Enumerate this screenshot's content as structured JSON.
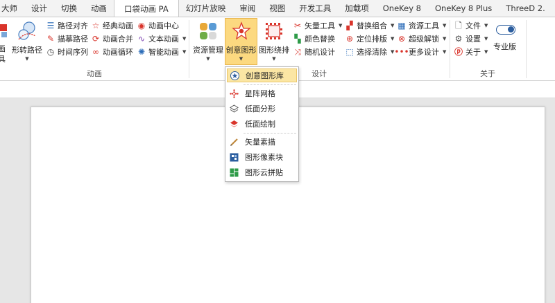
{
  "tabs": [
    {
      "label": "大师",
      "active": false
    },
    {
      "label": "设计",
      "active": false
    },
    {
      "label": "切换",
      "active": false
    },
    {
      "label": "动画",
      "active": false
    },
    {
      "label": "口袋动画 PA",
      "active": true
    },
    {
      "label": "幻灯片放映",
      "active": false
    },
    {
      "label": "审阅",
      "active": false
    },
    {
      "label": "视图",
      "active": false
    },
    {
      "label": "开发工具",
      "active": false
    },
    {
      "label": "加载项",
      "active": false
    },
    {
      "label": "OneKey 8",
      "active": false
    },
    {
      "label": "OneKey 8 Plus",
      "active": false
    },
    {
      "label": "ThreeD 2.",
      "active": false
    }
  ],
  "groups": {
    "animation": {
      "label": "动画",
      "partial_big_top": "画",
      "partial_big_bottom": "具",
      "path_convert": "形转路径",
      "items": [
        "路径对齐",
        "描摹路径",
        "时间序列",
        "经典动画",
        "动画合并",
        "动画循环",
        "动画中心",
        "文本动画",
        "智能动画"
      ]
    },
    "design": {
      "label": "设计",
      "resource_manage": "资源管理",
      "creative_shape": "创意图形",
      "shape_arrange": "图形绕排",
      "items": [
        "矢量工具",
        "颜色替换",
        "随机设计",
        "替换组合",
        "定位排版",
        "选择清除",
        "资源工具",
        "超级解锁",
        "更多设计"
      ]
    },
    "about": {
      "label": "关于",
      "items": [
        "文件",
        "设置",
        "关于"
      ],
      "pro_label": "专业版"
    }
  },
  "menu": {
    "items": [
      {
        "label": "创意图形库",
        "icon": "star-badge-icon",
        "highlighted": true
      },
      {
        "label": "星阵网格",
        "icon": "dot-grid-icon",
        "highlighted": false
      },
      {
        "label": "低面分形",
        "icon": "layers-outline-icon",
        "highlighted": false
      },
      {
        "label": "低面绘制",
        "icon": "layers-red-icon",
        "highlighted": false
      },
      {
        "label": "矢量素描",
        "icon": "pencil-icon",
        "highlighted": false
      },
      {
        "label": "图形像素块",
        "icon": "pixel-block-icon",
        "highlighted": false
      },
      {
        "label": "图形云拼贴",
        "icon": "grid-tile-icon",
        "highlighted": false
      }
    ]
  },
  "colors": {
    "accent_pressed": "#fcd980",
    "menu_highlight": "#fbe6a4",
    "icon_red": "#d9342b",
    "icon_blue": "#2b6cb8",
    "icon_green": "#2e9b48"
  }
}
